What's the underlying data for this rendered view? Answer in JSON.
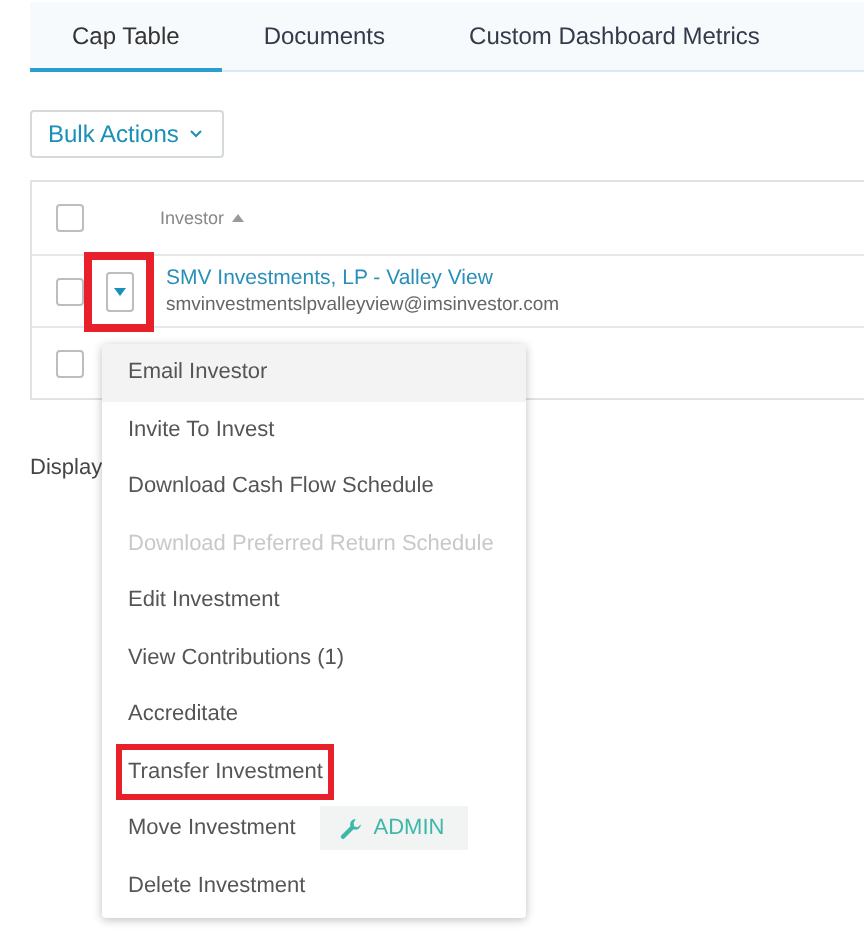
{
  "tabs": [
    {
      "label": "Cap Table",
      "selected": true
    },
    {
      "label": "Documents",
      "selected": false
    },
    {
      "label": "Custom Dashboard Metrics",
      "selected": false
    }
  ],
  "bulk_actions": {
    "label": "Bulk Actions"
  },
  "table": {
    "header": {
      "checked": false,
      "column": "Investor"
    },
    "rows": [
      {
        "checked": false,
        "name": "SMV Investments, LP - Valley View",
        "email": "smvinvestmentslpvalleyview@imsinvestor.com",
        "toggle_highlighted": true
      },
      {
        "checked": false
      }
    ]
  },
  "footer_text": "Display",
  "menu": [
    {
      "label": "Email Investor",
      "hovered": true,
      "disabled": false,
      "highlighted": false
    },
    {
      "label": "Invite To Invest",
      "hovered": false,
      "disabled": false,
      "highlighted": false
    },
    {
      "label": "Download Cash Flow Schedule",
      "hovered": false,
      "disabled": false,
      "highlighted": false
    },
    {
      "label": "Download Preferred Return Schedule",
      "hovered": false,
      "disabled": true,
      "highlighted": false
    },
    {
      "label": "Edit Investment",
      "hovered": false,
      "disabled": false,
      "highlighted": false
    },
    {
      "label": "View Contributions (1)",
      "hovered": false,
      "disabled": false,
      "highlighted": false
    },
    {
      "label": "Accreditate",
      "hovered": false,
      "disabled": false,
      "highlighted": false
    },
    {
      "label": "Transfer Investment",
      "hovered": false,
      "disabled": false,
      "highlighted": true
    },
    {
      "label": "Move Investment",
      "hovered": false,
      "disabled": false,
      "highlighted": false,
      "badge": "ADMIN"
    },
    {
      "label": "Delete Investment",
      "hovered": false,
      "disabled": false,
      "highlighted": false
    }
  ]
}
